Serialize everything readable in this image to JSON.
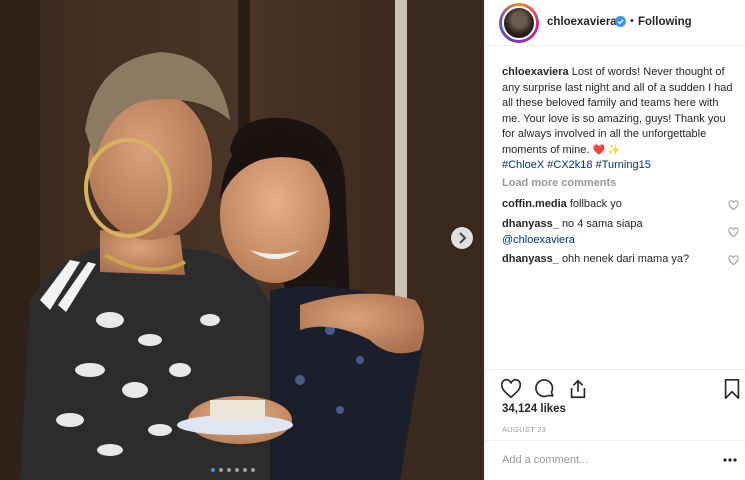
{
  "post": {
    "username": "chloexaviera",
    "verified": true,
    "follow_label": "Following",
    "separator": "•",
    "photo_alt": "",
    "carousel": {
      "count": 6,
      "active_index": 0
    }
  },
  "caption": {
    "username": "chloexaviera",
    "text": "Lost of words! Never thought of any surprise last night and all of a sudden I had all these beloved family and teams here with me. Your love is so amazing, guys! Thank you for always involved in all the unforgettable moments of mine.",
    "emojis": "❤️ ✨",
    "hashtags": [
      "#ChloeX",
      "#CX2k18",
      "#Turning15"
    ]
  },
  "load_more_label": "Load more comments",
  "comments": [
    {
      "username": "coffin.media",
      "text": "follback yo",
      "mention": ""
    },
    {
      "username": "dhanyass_",
      "text": "no 4 sama siapa",
      "mention": "@chloexaviera"
    },
    {
      "username": "dhanyass_",
      "text": "ohh nenek dari mama ya?",
      "mention": ""
    }
  ],
  "icons": {
    "like": "heart-outline-icon",
    "comment": "comment-bubble-icon",
    "share": "share-upload-icon",
    "save": "bookmark-icon",
    "more": "ellipsis-icon",
    "next": "chevron-right-icon"
  },
  "likes_label": "34,124 likes",
  "date_label": "AUGUST 23",
  "add_comment": {
    "placeholder": "Add a comment..."
  },
  "colors": {
    "link": "#003569",
    "muted": "#999999",
    "verified": "#3897f0",
    "active_dot": "#3897f0"
  }
}
